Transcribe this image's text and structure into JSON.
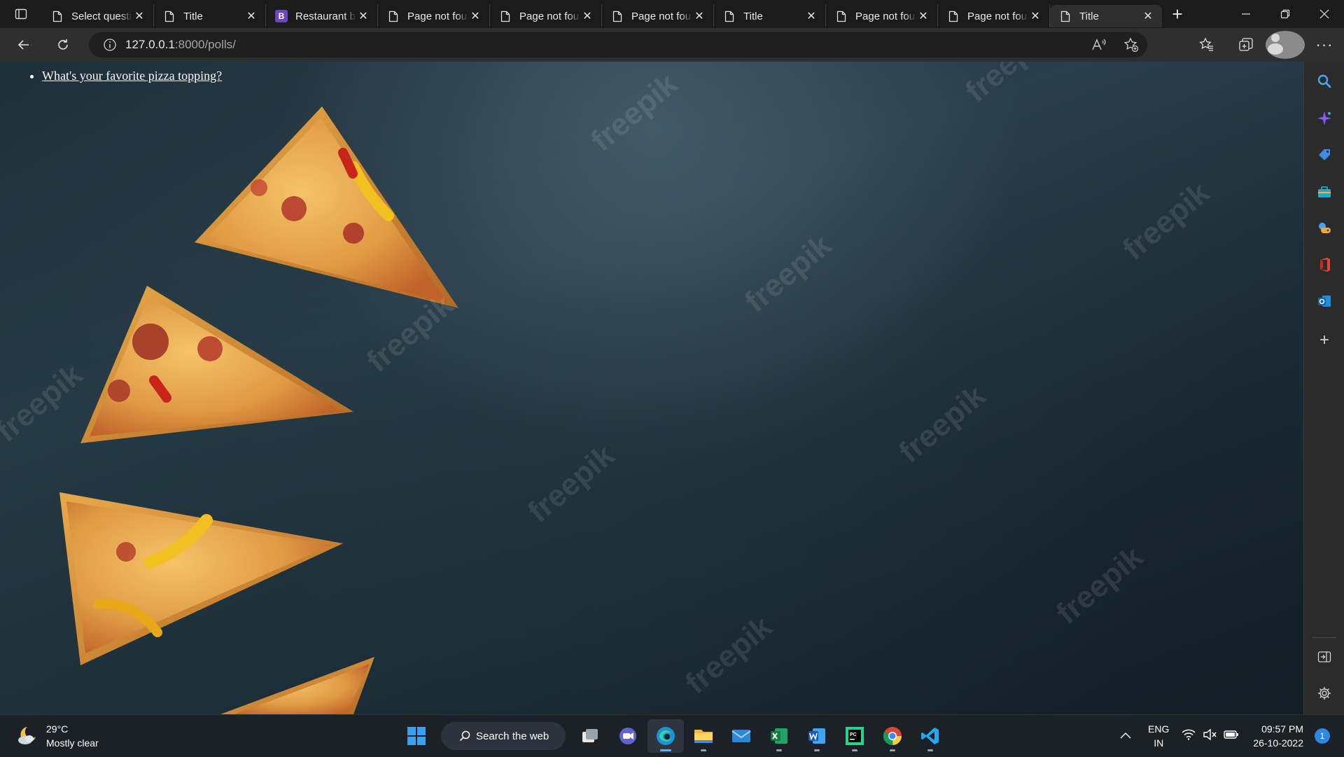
{
  "browser": {
    "tabs": [
      {
        "title": "Select question",
        "icon": "page-icon",
        "active": false
      },
      {
        "title": "Title",
        "icon": "page-icon",
        "active": false
      },
      {
        "title": "Restaurant by",
        "icon": "bootstrap-favicon",
        "favicon_letter": "B",
        "active": false
      },
      {
        "title": "Page not found",
        "icon": "page-icon",
        "active": false
      },
      {
        "title": "Page not found",
        "icon": "page-icon",
        "active": false
      },
      {
        "title": "Page not found",
        "icon": "page-icon",
        "active": false
      },
      {
        "title": "Title",
        "icon": "page-icon",
        "active": false
      },
      {
        "title": "Page not found",
        "icon": "page-icon",
        "active": false
      },
      {
        "title": "Page not found",
        "icon": "page-icon",
        "active": false
      },
      {
        "title": "Title",
        "icon": "page-icon",
        "active": true
      }
    ],
    "address": {
      "host": "127.0.0.1",
      "path": ":8000/polls/"
    }
  },
  "page": {
    "polls": [
      {
        "question": "What's your favorite pizza topping?"
      }
    ],
    "watermark_text": "freepik"
  },
  "taskbar": {
    "weather": {
      "temp": "29°C",
      "condition": "Mostly clear"
    },
    "search_label": "Search the web",
    "lang": {
      "line1": "ENG",
      "line2": "IN"
    },
    "clock": {
      "time": "09:57 PM",
      "date": "26-10-2022"
    },
    "notification_count": "1",
    "apps": [
      "task-view",
      "teams-chat",
      "edge",
      "file-explorer",
      "mail",
      "excel",
      "word",
      "pycharm",
      "chrome",
      "vscode"
    ]
  },
  "colors": {
    "tab_strip": "#1b1b1b",
    "toolbar": "#2f2f2f",
    "edge_blue": "#1e90d8",
    "taskbar": "#1c2128",
    "slate_bg": "#1e2f39"
  }
}
